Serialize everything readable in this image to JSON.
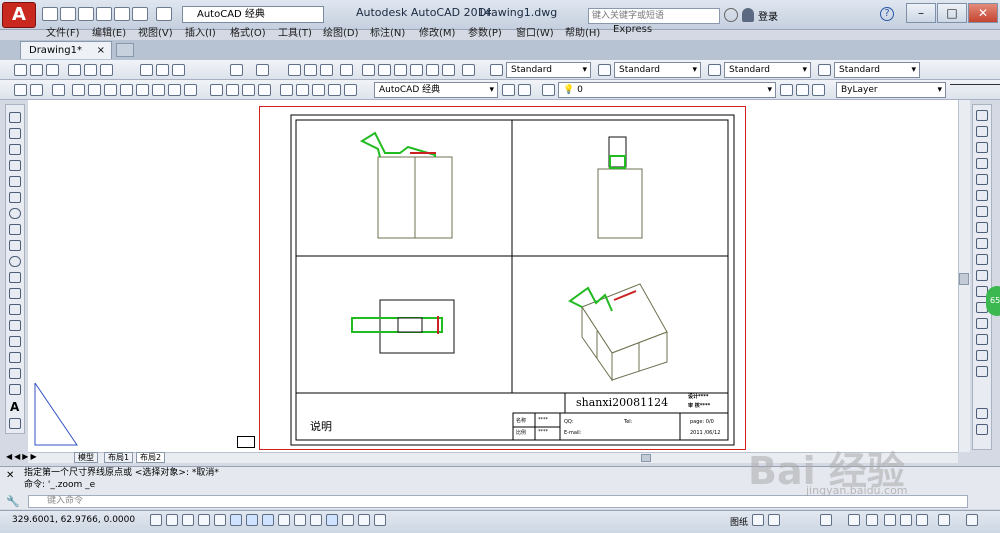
{
  "titlebar": {
    "app_title": "Autodesk AutoCAD 2014",
    "doc_title": "Drawing1.dwg",
    "workspace": "AutoCAD 经典",
    "search_placeholder": "键入关键字或短语",
    "login": "登录",
    "help": "?"
  },
  "menu": [
    "文件(F)",
    "编辑(E)",
    "视图(V)",
    "插入(I)",
    "格式(O)",
    "工具(T)",
    "绘图(D)",
    "标注(N)",
    "修改(M)",
    "参数(P)",
    "窗口(W)",
    "帮助(H)",
    "Express"
  ],
  "tabs": {
    "doc": "Drawing1*",
    "close": "×"
  },
  "styles": {
    "text": "Standard",
    "dim": "Standard",
    "table": "Standard",
    "mleader": "Standard"
  },
  "toolbar2": {
    "workspace": "AutoCAD 经典",
    "layer": "0",
    "color": "ByLayer"
  },
  "layouts": {
    "model": "模型",
    "layout1": "布局1",
    "layout2": "布局2"
  },
  "titleblock": {
    "name": "shanxi20081124",
    "note": "说明",
    "designer": "设计****",
    "checker": "审 核****",
    "r1a": "名称",
    "r1b": "****",
    "r2a": "比例",
    "r2b": "****",
    "qq": "QQ:",
    "tel": "Tel:",
    "email": "E-mail:",
    "page": "page: 0/0",
    "date": "2011 /06/12"
  },
  "command": {
    "line1": "指定第一个尺寸界线原点或 <选择对象>: *取消*",
    "line2": "命令: '_.zoom _e",
    "input_placeholder": "键入命令"
  },
  "status": {
    "coords": "329.6001, 62.9766, 0.0000",
    "paper": "图纸"
  },
  "watermark": {
    "main": "Bai 经验",
    "sub": "jingyan.baidu.com"
  },
  "badge": "65",
  "colors": {
    "accent": "#c8281e",
    "paper_border": "#d02020",
    "green": "#22bb22"
  }
}
